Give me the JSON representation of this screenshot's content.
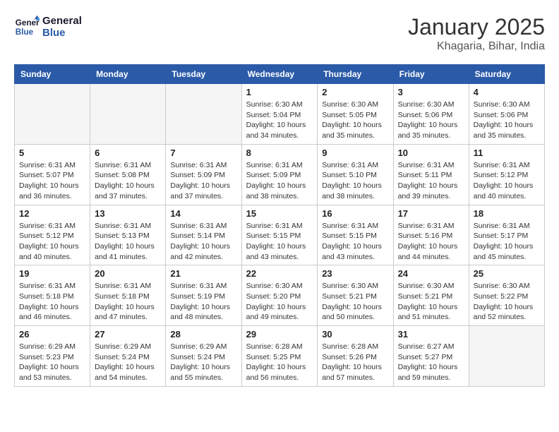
{
  "logo": {
    "line1": "General",
    "line2": "Blue"
  },
  "title": "January 2025",
  "subtitle": "Khagaria, Bihar, India",
  "weekdays": [
    "Sunday",
    "Monday",
    "Tuesday",
    "Wednesday",
    "Thursday",
    "Friday",
    "Saturday"
  ],
  "weeks": [
    [
      {
        "day": "",
        "info": ""
      },
      {
        "day": "",
        "info": ""
      },
      {
        "day": "",
        "info": ""
      },
      {
        "day": "1",
        "info": "Sunrise: 6:30 AM\nSunset: 5:04 PM\nDaylight: 10 hours\nand 34 minutes."
      },
      {
        "day": "2",
        "info": "Sunrise: 6:30 AM\nSunset: 5:05 PM\nDaylight: 10 hours\nand 35 minutes."
      },
      {
        "day": "3",
        "info": "Sunrise: 6:30 AM\nSunset: 5:06 PM\nDaylight: 10 hours\nand 35 minutes."
      },
      {
        "day": "4",
        "info": "Sunrise: 6:30 AM\nSunset: 5:06 PM\nDaylight: 10 hours\nand 35 minutes."
      }
    ],
    [
      {
        "day": "5",
        "info": "Sunrise: 6:31 AM\nSunset: 5:07 PM\nDaylight: 10 hours\nand 36 minutes."
      },
      {
        "day": "6",
        "info": "Sunrise: 6:31 AM\nSunset: 5:08 PM\nDaylight: 10 hours\nand 37 minutes."
      },
      {
        "day": "7",
        "info": "Sunrise: 6:31 AM\nSunset: 5:09 PM\nDaylight: 10 hours\nand 37 minutes."
      },
      {
        "day": "8",
        "info": "Sunrise: 6:31 AM\nSunset: 5:09 PM\nDaylight: 10 hours\nand 38 minutes."
      },
      {
        "day": "9",
        "info": "Sunrise: 6:31 AM\nSunset: 5:10 PM\nDaylight: 10 hours\nand 38 minutes."
      },
      {
        "day": "10",
        "info": "Sunrise: 6:31 AM\nSunset: 5:11 PM\nDaylight: 10 hours\nand 39 minutes."
      },
      {
        "day": "11",
        "info": "Sunrise: 6:31 AM\nSunset: 5:12 PM\nDaylight: 10 hours\nand 40 minutes."
      }
    ],
    [
      {
        "day": "12",
        "info": "Sunrise: 6:31 AM\nSunset: 5:12 PM\nDaylight: 10 hours\nand 40 minutes."
      },
      {
        "day": "13",
        "info": "Sunrise: 6:31 AM\nSunset: 5:13 PM\nDaylight: 10 hours\nand 41 minutes."
      },
      {
        "day": "14",
        "info": "Sunrise: 6:31 AM\nSunset: 5:14 PM\nDaylight: 10 hours\nand 42 minutes."
      },
      {
        "day": "15",
        "info": "Sunrise: 6:31 AM\nSunset: 5:15 PM\nDaylight: 10 hours\nand 43 minutes."
      },
      {
        "day": "16",
        "info": "Sunrise: 6:31 AM\nSunset: 5:15 PM\nDaylight: 10 hours\nand 43 minutes."
      },
      {
        "day": "17",
        "info": "Sunrise: 6:31 AM\nSunset: 5:16 PM\nDaylight: 10 hours\nand 44 minutes."
      },
      {
        "day": "18",
        "info": "Sunrise: 6:31 AM\nSunset: 5:17 PM\nDaylight: 10 hours\nand 45 minutes."
      }
    ],
    [
      {
        "day": "19",
        "info": "Sunrise: 6:31 AM\nSunset: 5:18 PM\nDaylight: 10 hours\nand 46 minutes."
      },
      {
        "day": "20",
        "info": "Sunrise: 6:31 AM\nSunset: 5:18 PM\nDaylight: 10 hours\nand 47 minutes."
      },
      {
        "day": "21",
        "info": "Sunrise: 6:31 AM\nSunset: 5:19 PM\nDaylight: 10 hours\nand 48 minutes."
      },
      {
        "day": "22",
        "info": "Sunrise: 6:30 AM\nSunset: 5:20 PM\nDaylight: 10 hours\nand 49 minutes."
      },
      {
        "day": "23",
        "info": "Sunrise: 6:30 AM\nSunset: 5:21 PM\nDaylight: 10 hours\nand 50 minutes."
      },
      {
        "day": "24",
        "info": "Sunrise: 6:30 AM\nSunset: 5:21 PM\nDaylight: 10 hours\nand 51 minutes."
      },
      {
        "day": "25",
        "info": "Sunrise: 6:30 AM\nSunset: 5:22 PM\nDaylight: 10 hours\nand 52 minutes."
      }
    ],
    [
      {
        "day": "26",
        "info": "Sunrise: 6:29 AM\nSunset: 5:23 PM\nDaylight: 10 hours\nand 53 minutes."
      },
      {
        "day": "27",
        "info": "Sunrise: 6:29 AM\nSunset: 5:24 PM\nDaylight: 10 hours\nand 54 minutes."
      },
      {
        "day": "28",
        "info": "Sunrise: 6:29 AM\nSunset: 5:24 PM\nDaylight: 10 hours\nand 55 minutes."
      },
      {
        "day": "29",
        "info": "Sunrise: 6:28 AM\nSunset: 5:25 PM\nDaylight: 10 hours\nand 56 minutes."
      },
      {
        "day": "30",
        "info": "Sunrise: 6:28 AM\nSunset: 5:26 PM\nDaylight: 10 hours\nand 57 minutes."
      },
      {
        "day": "31",
        "info": "Sunrise: 6:27 AM\nSunset: 5:27 PM\nDaylight: 10 hours\nand 59 minutes."
      },
      {
        "day": "",
        "info": ""
      }
    ]
  ]
}
